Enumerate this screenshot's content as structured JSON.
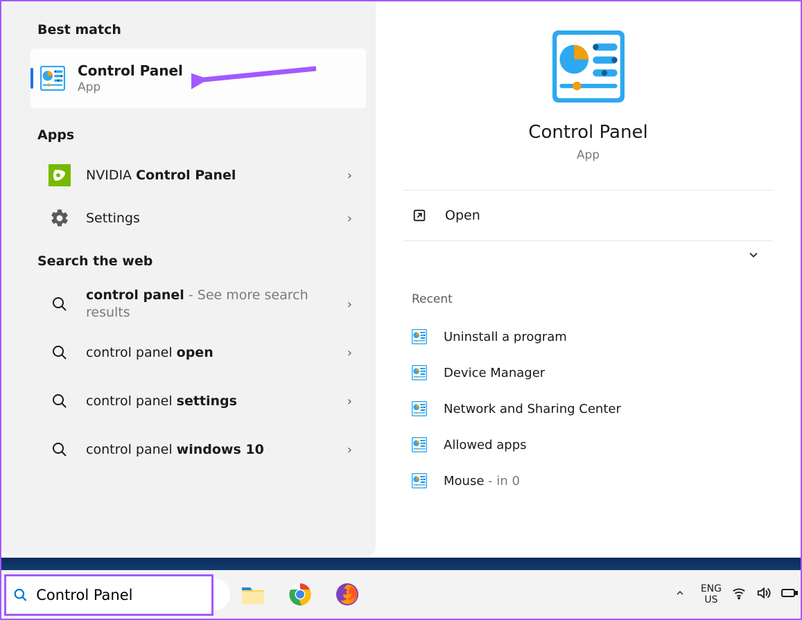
{
  "left": {
    "best_match_header": "Best match",
    "best_match": {
      "title": "Control Panel",
      "subtitle": "App"
    },
    "apps_header": "Apps",
    "apps": [
      {
        "prefix": "NVIDIA ",
        "bold": "Control Panel"
      },
      {
        "plain": "Settings"
      }
    ],
    "web_header": "Search the web",
    "web": [
      {
        "bold_start": true,
        "text_main": "control panel",
        "text_suffix": " - See more search results"
      },
      {
        "text_main": "control panel ",
        "text_bold_tail": "open"
      },
      {
        "text_main": "control panel ",
        "text_bold_tail": "settings"
      },
      {
        "text_main": "control panel ",
        "text_bold_tail": "windows 10"
      }
    ]
  },
  "right": {
    "title": "Control Panel",
    "subtitle": "App",
    "open_label": "Open",
    "recent_header": "Recent",
    "recent": [
      {
        "label": "Uninstall a program"
      },
      {
        "label": "Device Manager"
      },
      {
        "label": "Network and Sharing Center"
      },
      {
        "label": "Allowed apps"
      },
      {
        "label_main": "Mouse",
        "label_suffix": " - in 0"
      }
    ]
  },
  "taskbar": {
    "search_value": "Control Panel",
    "lang_line1": "ENG",
    "lang_line2": "US"
  }
}
